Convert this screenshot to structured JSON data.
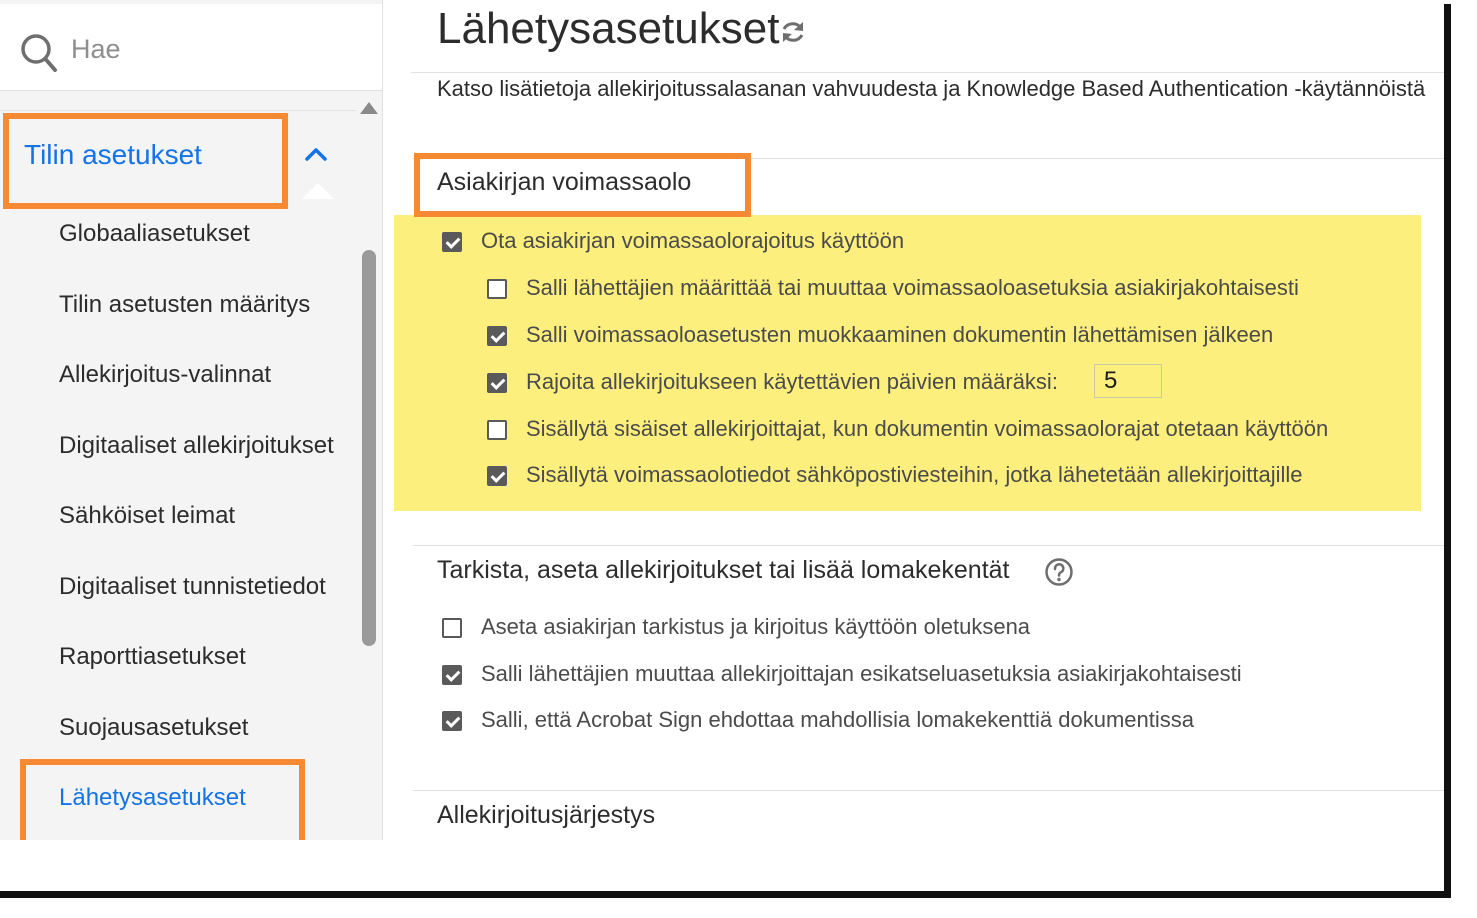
{
  "search": {
    "placeholder": "Hae"
  },
  "sidebar": {
    "group_label": "Tilin asetukset",
    "items": [
      {
        "label": "Globaaliasetukset"
      },
      {
        "label": "Tilin asetusten määritys"
      },
      {
        "label": "Allekirjoitus-valinnat"
      },
      {
        "label": "Digitaaliset allekirjoitukset"
      },
      {
        "label": "Sähköiset leimat"
      },
      {
        "label": "Digitaaliset tunnistetiedot"
      },
      {
        "label": "Raporttiasetukset"
      },
      {
        "label": "Suojausasetukset"
      },
      {
        "label": "Lähetysasetukset"
      }
    ],
    "active_item": "Lähetysasetukset"
  },
  "page": {
    "title": "Lähetysasetukset",
    "intro": "Katso lisätietoja allekirjoitussalasanan vahvuudesta ja Knowledge Based Authentication -käytännöistä"
  },
  "sections": {
    "expiration": {
      "title": "Asiakirjan voimassaolo",
      "options": [
        {
          "label": "Ota asiakirjan voimassaolorajoitus käyttöön",
          "checked": true
        },
        {
          "label": "Salli lähettäjien määrittää tai muuttaa voimassaoloasetuksia asiakirjakohtaisesti",
          "checked": false
        },
        {
          "label": "Salli voimassaoloasetusten muokkaaminen dokumentin lähettämisen jälkeen",
          "checked": true
        },
        {
          "label": "Rajoita allekirjoitukseen käytettävien päivien määräksi:",
          "checked": true
        },
        {
          "label": "Sisällytä sisäiset allekirjoittajat, kun dokumentin voimassaolorajat otetaan käyttöön",
          "checked": false
        },
        {
          "label": "Sisällytä voimassaolotiedot sähköpostiviesteihin, jotka lähetetään allekirjoittajille",
          "checked": true
        }
      ],
      "days_value": "5"
    },
    "review": {
      "title": "Tarkista, aseta allekirjoitukset tai lisää lomakekentät",
      "options": [
        {
          "label": "Aseta asiakirjan tarkistus ja kirjoitus käyttöön oletuksena",
          "checked": false
        },
        {
          "label": "Salli lähettäjien muuttaa allekirjoittajan esikatseluasetuksia asiakirjakohtaisesti",
          "checked": true
        },
        {
          "label": "Salli, että Acrobat Sign ehdottaa mahdollisia lomakekenttiä dokumentissa",
          "checked": true
        }
      ]
    },
    "signing_order": {
      "title": "Allekirjoitusjärjestys"
    }
  },
  "colors": {
    "accent": "#1473e6",
    "callout": "#f58a32",
    "highlight": "#fcef7d"
  },
  "icons": {
    "search": "search-icon",
    "chevron": "chevron-up-icon",
    "refresh": "refresh-icon",
    "help": "help-icon"
  }
}
